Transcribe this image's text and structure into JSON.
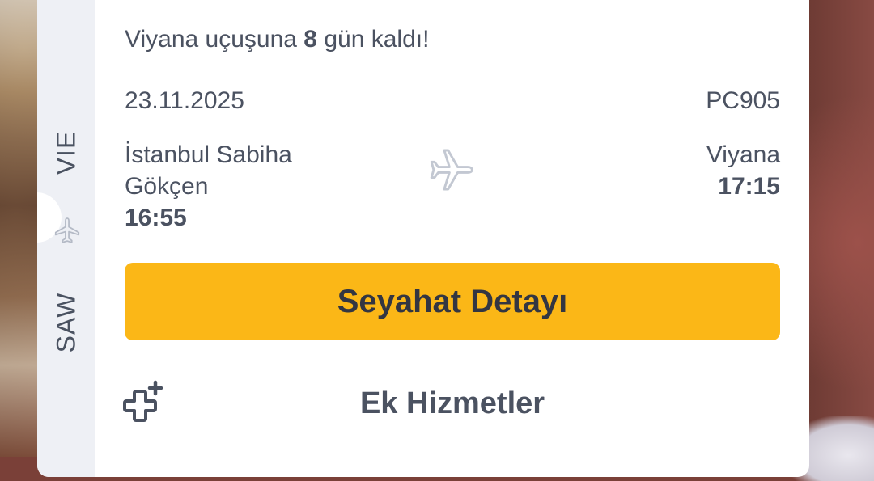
{
  "ticket": {
    "origin_code": "SAW",
    "destination_code": "VIE",
    "progress_icon": "plane-icon",
    "countdown_prefix": "Viyana uçuşuna",
    "countdown_days": "8",
    "countdown_suffix": "gün kaldı!",
    "date": "23.11.2025",
    "flight_number": "PC905",
    "origin_name": "İstanbul Sabiha Gökçen",
    "departure_time": "16:55",
    "destination_name": "Viyana",
    "arrival_time": "17:15",
    "route_icon": "plane-icon"
  },
  "actions": {
    "detail_label": "Seyahat Detayı",
    "extras_label": "Ek Hizmetler",
    "extras_icon": "add-service-icon"
  },
  "colors": {
    "accent": "#fbb717",
    "text": "#4b5261",
    "stub_bg": "#eef0f5"
  }
}
